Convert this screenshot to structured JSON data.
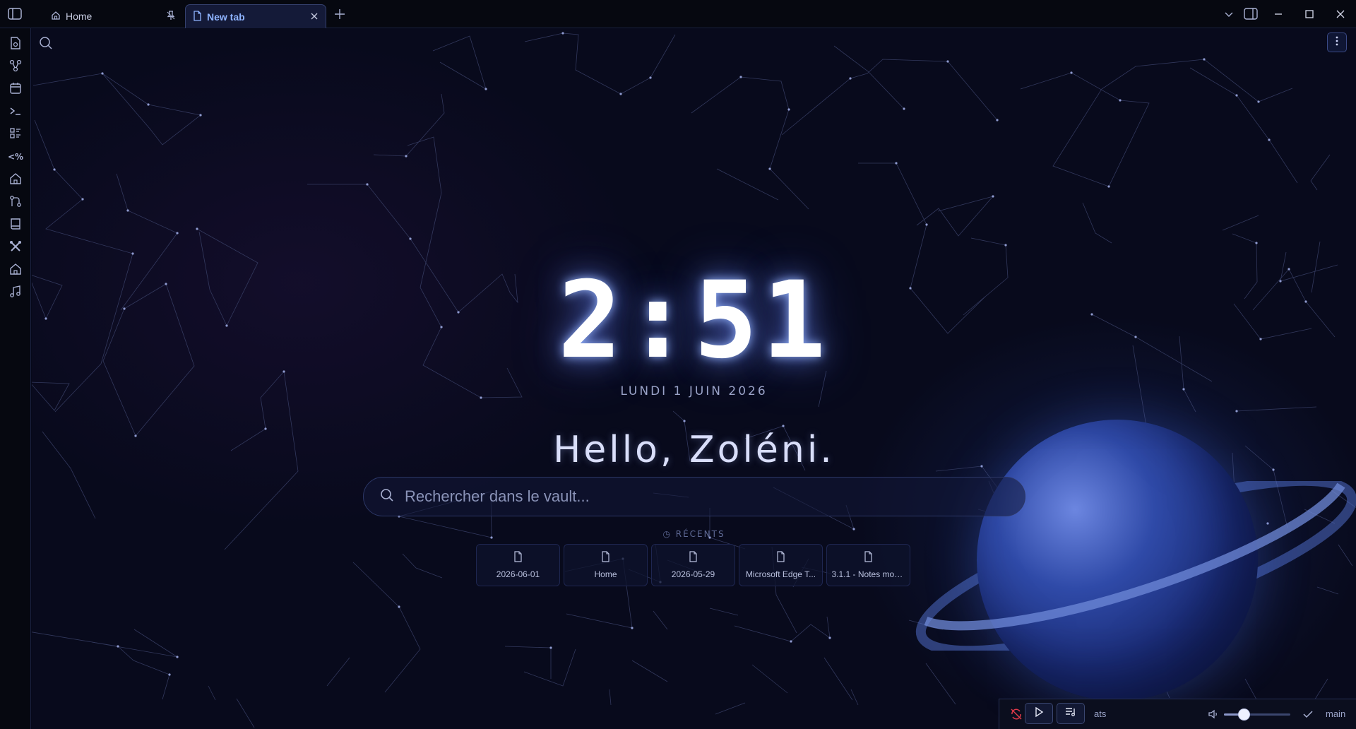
{
  "tabs": [
    {
      "label": "Home",
      "icon": "home-icon",
      "pinned": true
    },
    {
      "label": "New tab",
      "icon": "file-icon",
      "active": true
    }
  ],
  "main": {
    "clock": "2:51",
    "date": "LUNDI 1 JUIN 2026",
    "greeting": "Hello, Zoléni.",
    "search": {
      "placeholder": "Rechercher dans le vault..."
    },
    "recents": {
      "label": "RÉCENTS",
      "items": [
        {
          "label": "2026-06-01"
        },
        {
          "label": "Home"
        },
        {
          "label": "2026-05-29"
        },
        {
          "label": "Microsoft Edge T..."
        },
        {
          "label": "3.1.1 - Notes mod..."
        }
      ]
    }
  },
  "ribbon": {
    "items": [
      "new-note-icon",
      "graph-icon",
      "calendar-icon",
      "terminal-icon",
      "list-icon",
      "templater-icon",
      "home-icon",
      "git-icon",
      "book-icon",
      "tools-icon",
      "home-alt-icon",
      "music-icon"
    ]
  },
  "player": {
    "track": "ats",
    "volume": 0.3,
    "branch": "main"
  },
  "colors": {
    "accent": "#8fb4ff",
    "background": "#080a1c",
    "panel": "#060810"
  }
}
